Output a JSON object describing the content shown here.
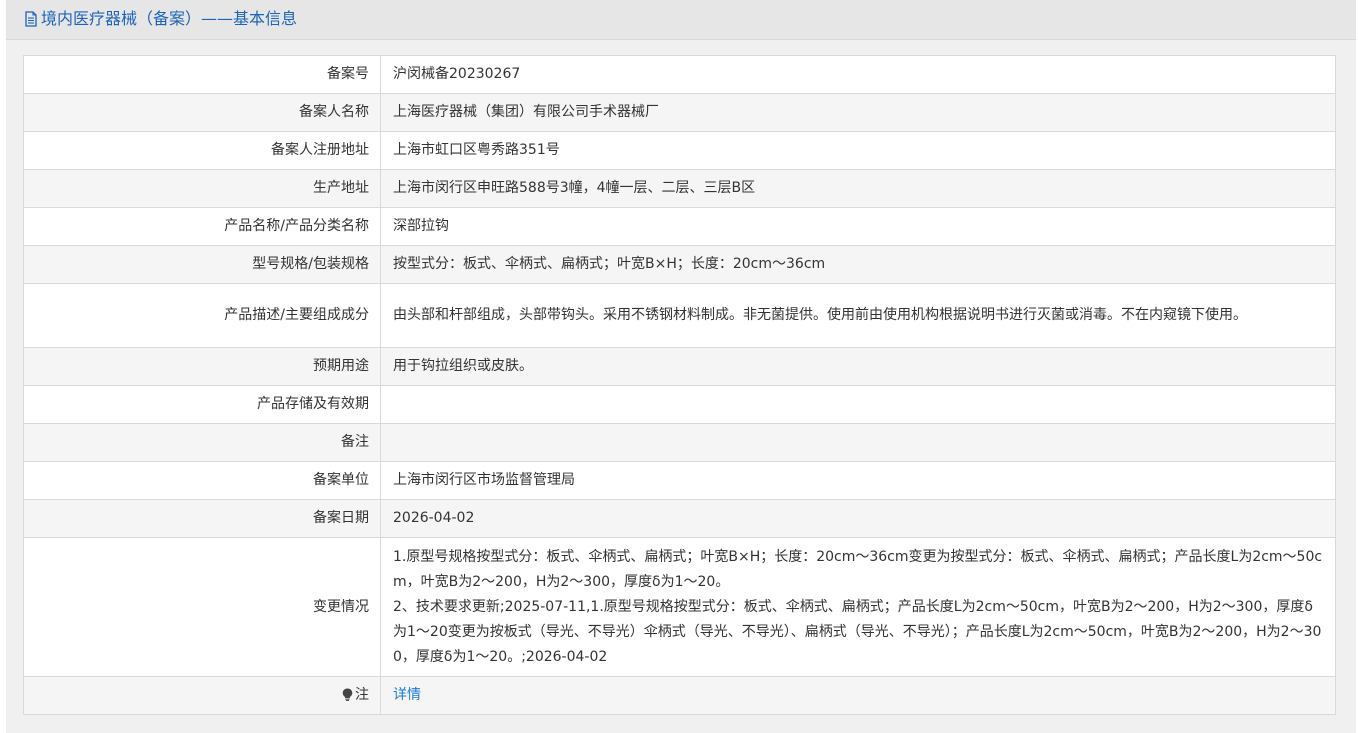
{
  "header": {
    "title": "境内医疗器械（备案）——基本信息",
    "icon": "document-icon",
    "accent_color": "#1e64b4"
  },
  "rows": [
    {
      "label": "备案号",
      "value": "沪闵械备20230267"
    },
    {
      "label": "备案人名称",
      "value": "上海医疗器械（集团）有限公司手术器械厂"
    },
    {
      "label": "备案人注册地址",
      "value": "上海市虹口区粤秀路351号"
    },
    {
      "label": "生产地址",
      "value": "上海市闵行区申旺路588号3幢，4幢一层、二层、三层B区"
    },
    {
      "label": "产品名称/产品分类名称",
      "value": "深部拉钩"
    },
    {
      "label": "型号规格/包装规格",
      "value": "按型式分：板式、伞柄式、扁柄式；叶宽B×H；长度：20cm～36cm"
    },
    {
      "label": "产品描述/主要组成成分",
      "value": "由头部和杆部组成，头部带钩头。采用不锈钢材料制成。非无菌提供。使用前由使用机构根据说明书进行灭菌或消毒。不在内窥镜下使用。"
    },
    {
      "label": "预期用途",
      "value": "用于钩拉组织或皮肤。"
    },
    {
      "label": "产品存储及有效期",
      "value": ""
    },
    {
      "label": "备注",
      "value": ""
    },
    {
      "label": "备案单位",
      "value": "上海市闵行区市场监督管理局"
    },
    {
      "label": "备案日期",
      "value": "2026-04-02"
    },
    {
      "label": "变更情况",
      "value": "1.原型号规格按型式分：板式、伞柄式、扁柄式；叶宽B×H；长度：20cm～36cm变更为按型式分：板式、伞柄式、扁柄式；产品长度L为2cm～50cm，叶宽B为2～200，H为2～300，厚度δ为1～20。\n2、技术要求更新;2025-07-11,1.原型号规格按型式分：板式、伞柄式、扁柄式；产品长度L为2cm～50cm，叶宽B为2～200，H为2～300，厚度δ为1～20变更为按板式（导光、不导光）伞柄式（导光、不导光）、扁柄式（导光、不导光）；产品长度L为2cm～50cm，叶宽B为2～200，H为2～300，厚度δ为1～20。;2026-04-02"
    },
    {
      "label": "注",
      "value": "详情",
      "icon": "lightbulb-icon"
    }
  ]
}
